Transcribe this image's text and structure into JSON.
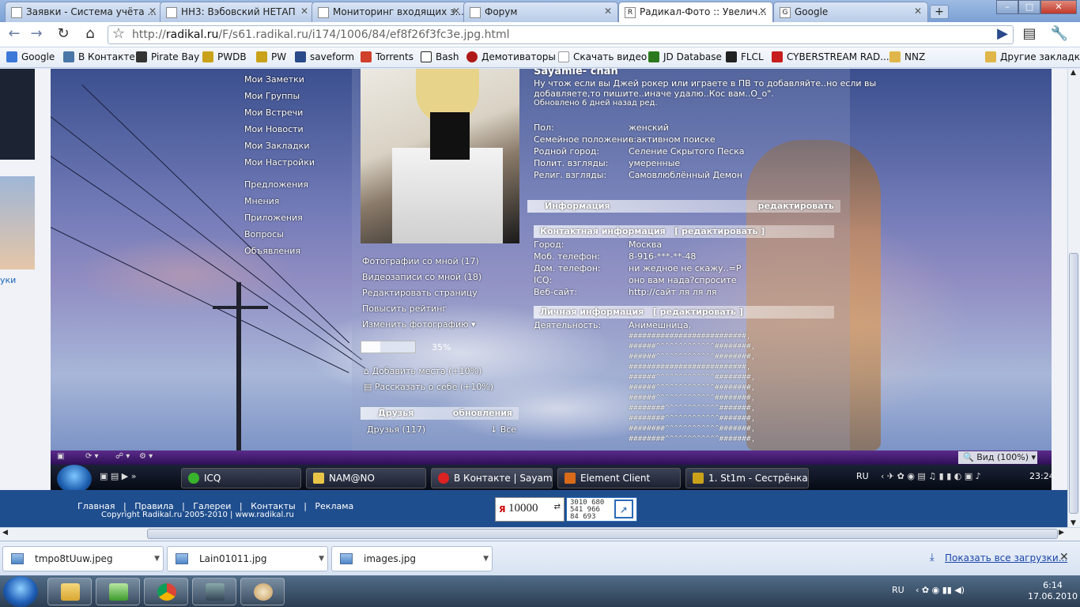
{
  "tabs": [
    {
      "label": "Заявки - Система учёта ...",
      "active": false
    },
    {
      "label": "НН3: Вэбовский НЕТАП",
      "active": false
    },
    {
      "label": "Мониторинг входящих з...",
      "active": false
    },
    {
      "label": "Форум",
      "active": false
    },
    {
      "label": "Радикал-Фото :: Увелич...",
      "active": true
    },
    {
      "label": "Google",
      "active": false
    }
  ],
  "window_controls": {
    "minimize": "–",
    "maximize": "□",
    "close": "✕"
  },
  "address": {
    "scheme": "http://",
    "host": "radikal.ru",
    "path": "/F/s61.radikal.ru/i174/1006/84/ef8f26f3fc3e.jpg.html"
  },
  "bookmarks": [
    {
      "label": "Google",
      "color": "#3c78d8"
    },
    {
      "label": "В Контакте",
      "color": "#4a76a8"
    },
    {
      "label": "Pirate Bay",
      "color": "#333333"
    },
    {
      "label": "PWDB",
      "color": "#c9a21a"
    },
    {
      "label": "PW",
      "color": "#c9a21a"
    },
    {
      "label": "saveform",
      "color": "#2b4a8a"
    },
    {
      "label": "Torrents",
      "color": "#d0402b"
    },
    {
      "label": "Bash",
      "color": "#222222"
    },
    {
      "label": "Демотиваторы",
      "color": "#b01818"
    },
    {
      "label": "Скачать видео!",
      "color": "#ffffff"
    },
    {
      "label": "JD Database",
      "color": "#2d7a1e"
    },
    {
      "label": "FLCL",
      "color": "#222222"
    },
    {
      "label": "CYBERSTREAM RAD...",
      "color": "#c81e1e"
    },
    {
      "label": "NNZ",
      "color": "#e0b64a"
    }
  ],
  "other_bookmarks": "Другие закладки",
  "left_link": "уки",
  "sidebar_menu": [
    "Мои Заметки",
    "Мои Группы",
    "Мои Встречи",
    "Мои Новости",
    "Мои Закладки",
    "Мои Настройки",
    "Предложения",
    "Мнения",
    "Приложения",
    "Вопросы",
    "Объявления"
  ],
  "profile": {
    "name": "Sayamie- chan",
    "status": "Ну чтож если вы Джей рокер или играете в ПВ то добавляйте..но если вы",
    "status2": "добавляете,то пишите..иначе удалю..Кос вам..О_о\".",
    "updated": "Обновлено 6 дней назад ред.",
    "fields": [
      {
        "label": "Пол:",
        "value": "женский"
      },
      {
        "label": "Семейное положение:",
        "value": "в активном поиске"
      },
      {
        "label": "Родной город:",
        "value": "Селение Скрытого Песка"
      },
      {
        "label": "Полит. взгляды:",
        "value": "умеренные"
      },
      {
        "label": "Религ. взгляды:",
        "value": "Самовлюблённый Демон"
      }
    ],
    "info_header": "Информация",
    "edit": "редактировать",
    "contact_header": "Контактная информация",
    "contact_edit": "[ редактировать ]",
    "contacts": [
      {
        "label": "Город:",
        "value": "Москва"
      },
      {
        "label": "Моб. телефон:",
        "value": "8-916-***-**-48"
      },
      {
        "label": "Дом. телефон:",
        "value": "ни жедное не скажу..=Р"
      },
      {
        "label": "ICQ:",
        "value": "оно вам нада?спросите"
      },
      {
        "label": "Веб-сайт:",
        "value": "http://сайт ля ля ля"
      }
    ],
    "personal_header": "Личная информация",
    "personal_edit": "[ редактировать ]",
    "activity_label": "Деятельность:",
    "activity_value": "Анимешница,",
    "hash_lines": [
      "##########################,",
      "######^^^^^^^^^^^^^########,",
      "######^^^^^^^^^^^^^########,",
      "##########################,",
      "######^^^^^^^^^^^^^########,",
      "######^^^^^^^^^^^^^########,",
      "######^^^^^^^^^^^^^########,",
      "########^^^^^^^^^^^^#######,",
      "########^^^^^^^^^^^^#######,",
      "########^^^^^^^^^^^^#######,",
      "########^^^^^^^^^^^^#######,"
    ]
  },
  "photo_links": [
    "Фотографии со мной (17)",
    "Видеозаписи со мной (18)",
    "Редактировать страницу",
    "Повысить рейтинг",
    "Изменить фотографию"
  ],
  "rating": {
    "percent_label": "35%",
    "value": 0.35
  },
  "add_places": "Добавить места (+10%)",
  "tell_about": "Рассказать о себе (+10%)",
  "friends": {
    "header": "Друзья",
    "updates": "обновления",
    "count_label": "Друзья (117)",
    "all": "↓ Все"
  },
  "ie_zoom": "Вид (100%)",
  "inner_taskbar": [
    {
      "label": "ICQ",
      "color": "#38b32b"
    },
    {
      "label": "NAM@NO",
      "color": "#e8c547"
    },
    {
      "label": "В Контакте | Sayam...",
      "color": "#d22"
    },
    {
      "label": "Element Client",
      "color": "#d86a1a"
    },
    {
      "label": "1. St1m - Сестрёнка...",
      "color": "#c9a21a"
    }
  ],
  "inner_lang": "RU",
  "inner_clock": "23:24",
  "footer": {
    "links": "Главная   |   Правила   |   Галереи   |   Контакты   |   Реклама",
    "copyright": "Copyright Radikal.ru 2005-2010  |  www.radikal.ru",
    "counter_value": "10000",
    "counter_stats": [
      "3010 680",
      "541 966",
      "84 693"
    ]
  },
  "downloads": [
    {
      "name": "tmpo8tUuw.jpeg"
    },
    {
      "name": "Lain01011.jpg"
    },
    {
      "name": "images.jpg"
    }
  ],
  "show_all_downloads": "Показать все загрузки...",
  "taskbar": {
    "lang": "RU",
    "time": "6:14",
    "date": "17.06.2010"
  }
}
